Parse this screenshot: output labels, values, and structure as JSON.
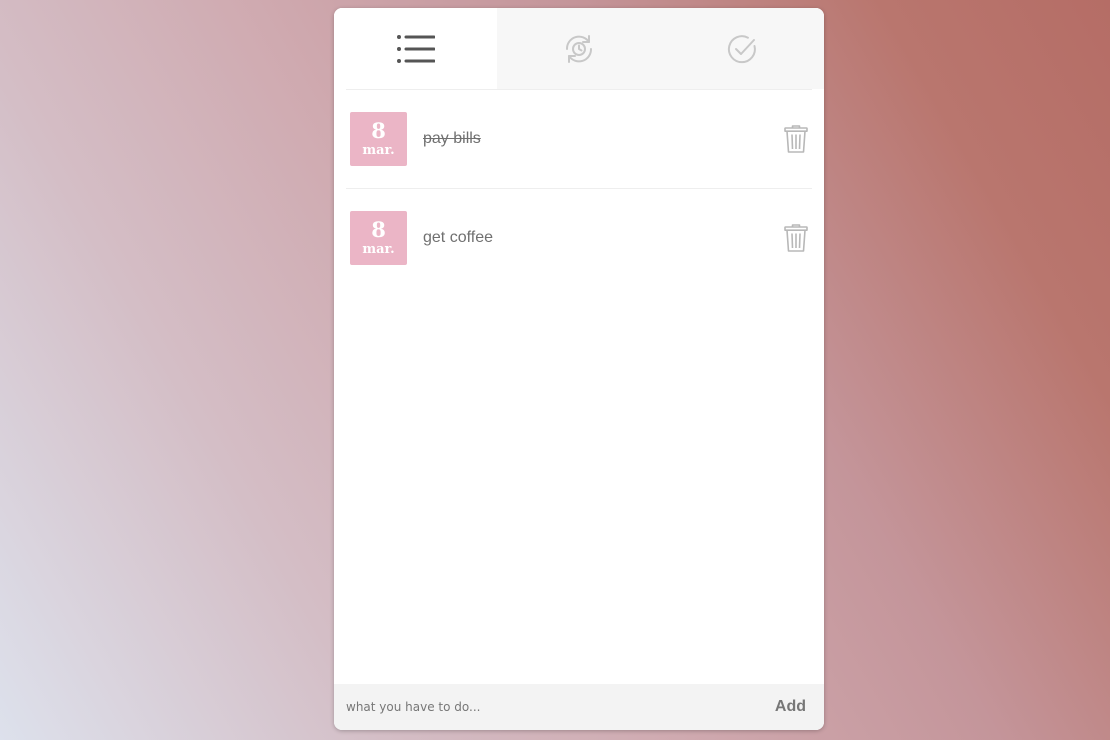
{
  "tabs": [
    {
      "id": "all",
      "icon": "list-icon",
      "active": true
    },
    {
      "id": "pending",
      "icon": "history-icon",
      "active": false
    },
    {
      "id": "completed",
      "icon": "check-circle-icon",
      "active": false
    }
  ],
  "todos": [
    {
      "day": "8",
      "month": "mar.",
      "text": "pay bills",
      "completed": true
    },
    {
      "day": "8",
      "month": "mar.",
      "text": "get coffee",
      "completed": false
    }
  ],
  "input": {
    "placeholder": "what you have to do...",
    "value": ""
  },
  "add_label": "Add",
  "colors": {
    "date_badge": "#ebb5c6",
    "icon": "#c8c8c8",
    "icon_active": "#555555",
    "text": "#707070"
  }
}
